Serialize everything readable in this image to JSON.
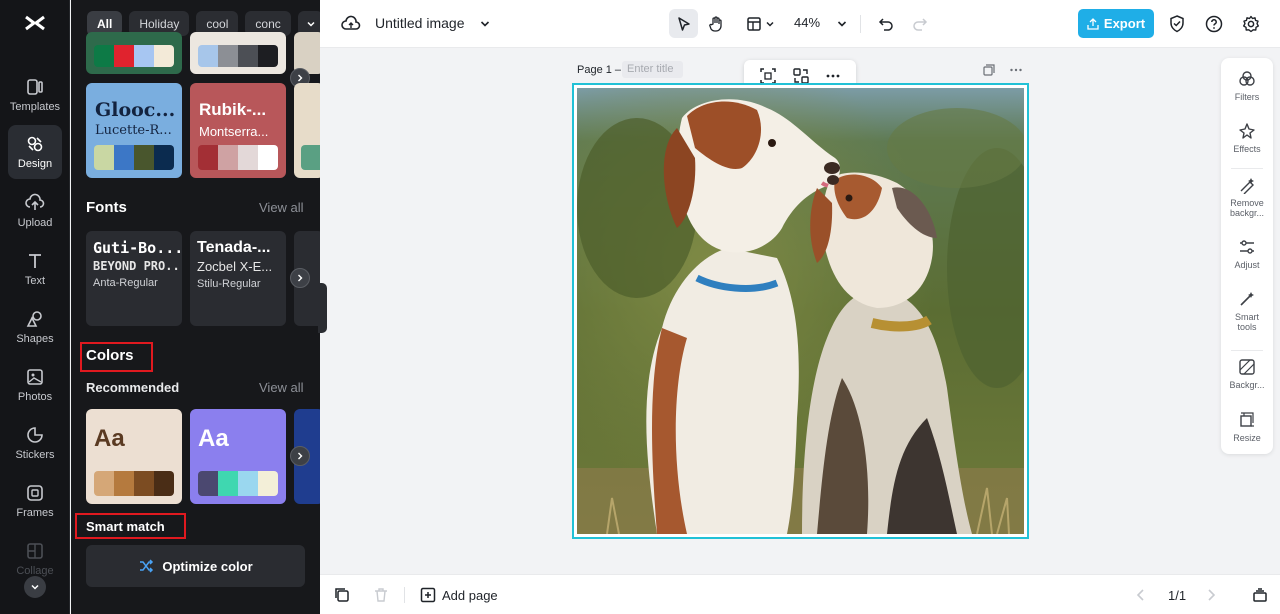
{
  "app": {
    "title": "Untitled image"
  },
  "rail": {
    "items": [
      {
        "label": "Templates",
        "icon": "templates-icon"
      },
      {
        "label": "Design",
        "icon": "design-icon"
      },
      {
        "label": "Upload",
        "icon": "upload-icon"
      },
      {
        "label": "Text",
        "icon": "text-icon"
      },
      {
        "label": "Shapes",
        "icon": "shapes-icon"
      },
      {
        "label": "Photos",
        "icon": "photos-icon"
      },
      {
        "label": "Stickers",
        "icon": "stickers-icon"
      },
      {
        "label": "Frames",
        "icon": "frames-icon"
      },
      {
        "label": "Collage",
        "icon": "collage-icon"
      }
    ]
  },
  "panel": {
    "filters": [
      "All",
      "Holiday",
      "cool",
      "conc"
    ],
    "theme_cards": [
      {
        "title": "Glooc...",
        "subtitle": "Lucette-R...",
        "bg": "#7aaedf",
        "title_color": "#13233f",
        "colors": [
          "#c9d7a3",
          "#3c77c6",
          "#49562d",
          "#0b2b4f"
        ]
      },
      {
        "title": "Rubik-...",
        "subtitle": "Montserra...",
        "bg": "#b8575a",
        "title_color": "#ffffff",
        "colors": [
          "#a32f35",
          "#cfa2a3",
          "#e3d8d8",
          "#ffffff"
        ]
      }
    ],
    "fonts": {
      "title": "Fonts",
      "view_all": "View all",
      "cards": [
        {
          "line1": "Guti-Bo...",
          "line2": "BEYOND PRO...",
          "line3": "Anta-Regular"
        },
        {
          "line1": "Tenada-...",
          "line2": "Zocbel X-E...",
          "line3": "Stilu-Regular"
        }
      ]
    },
    "colors": {
      "title": "Colors",
      "recommended": "Recommended",
      "view_all": "View all",
      "palettes": [
        {
          "label": "Aa",
          "bg": "#ecdfd2",
          "text_color": "#5a3a22",
          "colors": [
            "#d5a777",
            "#b57a3e",
            "#7c4c22",
            "#4a2d16"
          ]
        },
        {
          "label": "Aa",
          "bg": "#8b7fee",
          "text_color": "#ffffff",
          "colors": [
            "#4b4870",
            "#3fd7b0",
            "#9ad7ef",
            "#f3efd8"
          ]
        }
      ]
    },
    "smart_match": {
      "title": "Smart match",
      "button": "Optimize color"
    }
  },
  "topbar": {
    "zoom": "44%",
    "export": "Export"
  },
  "canvas": {
    "page_label": "Page 1 –",
    "title_placeholder": "Enter title"
  },
  "tools": [
    {
      "label": "Filters"
    },
    {
      "label": "Effects"
    },
    {
      "label": "Remove backgr..."
    },
    {
      "label": "Adjust"
    },
    {
      "label": "Smart tools"
    },
    {
      "label": "Backgr..."
    },
    {
      "label": "Resize"
    }
  ],
  "bottombar": {
    "add_page": "Add page",
    "page_count": "1/1"
  },
  "colors": {
    "accent": "#1faee7",
    "selection": "#21c1d6",
    "highlight_box": "#e0191f"
  }
}
